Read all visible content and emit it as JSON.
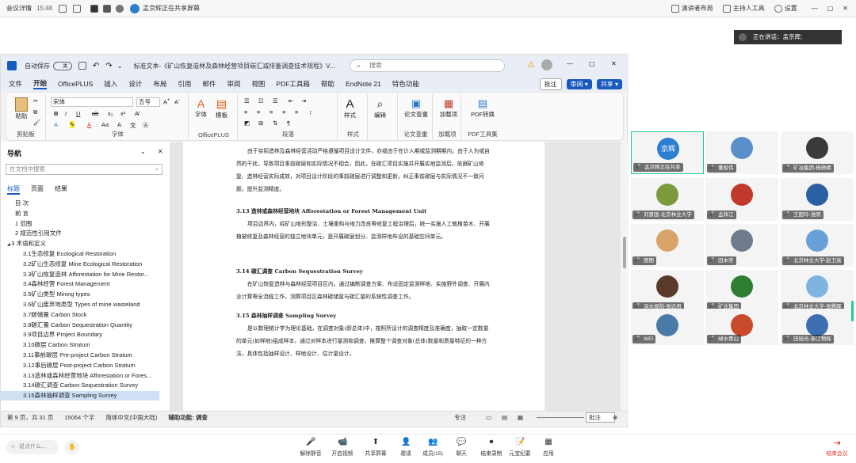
{
  "meeting": {
    "info": "会议详情",
    "time": "15:48",
    "sharing_banner": "孟京辉正在共享屏幕",
    "presenter_layout": "演讲者布局",
    "host_tools": "主持人工具",
    "settings": "设置",
    "speaking_label": "正在讲话：",
    "speaking_name": "孟京辉;"
  },
  "word": {
    "autosave": "自动保存",
    "autosave_state": "关",
    "doc_title": "标准文本-《矿山恢复造林及森林经营项目碳汇减排量调查技术规程》V...",
    "search_placeholder": "搜索",
    "menu": [
      "文件",
      "开始",
      "OfficePLUS",
      "插入",
      "设计",
      "布局",
      "引用",
      "邮件",
      "审阅",
      "视图",
      "PDF工具箱",
      "帮助",
      "EndNote 21",
      "特色功能"
    ],
    "comment_btn": "批注",
    "review_btn": "审阅",
    "share_btn": "共享",
    "ribbon": {
      "paste": "粘贴",
      "clipboard": "剪贴板",
      "font_name": "宋体",
      "font_size": "五号",
      "font_group": "字体",
      "font_btn": "字体",
      "template_btn": "模板",
      "officeplus": "OfficePLUS",
      "paragraph": "段落",
      "styles_btn": "样式",
      "styles_group": "样式",
      "edit_btn": "编辑",
      "paper_check": "论文查重",
      "paper_check_group": "论文查重",
      "addin_btn": "加载项",
      "addin_group": "加载项",
      "pdf_convert": "PDF转换",
      "pdf_group": "PDF工具集"
    },
    "nav": {
      "title": "导航",
      "search_placeholder": "在文档中搜索",
      "tabs": [
        "标题",
        "页面",
        "结果"
      ],
      "items": [
        {
          "text": "目 次",
          "level": 0
        },
        {
          "text": "前 言",
          "level": 0
        },
        {
          "text": "1 范围",
          "level": 0
        },
        {
          "text": "2 规范性引用文件",
          "level": 0
        },
        {
          "text": "3 术语和定义",
          "level": 0,
          "expanded": true
        },
        {
          "text": "3.1生态修复 Ecological Restoration",
          "level": 1
        },
        {
          "text": "3.2矿山生态修复 Mine Ecological Restoration",
          "level": 1
        },
        {
          "text": "3.3矿山恢复造林 Afforestation for Mine Restor...",
          "level": 1
        },
        {
          "text": "3.4森林经营 Forest Management",
          "level": 1
        },
        {
          "text": "3.5矿山类型 Mining types",
          "level": 1
        },
        {
          "text": "3.6矿山废弃地类型 Types of mine wasteland",
          "level": 1
        },
        {
          "text": "3.7碳储量 Carbon Stock",
          "level": 1
        },
        {
          "text": "3.8碳汇量 Carbon Sequestration Quantity",
          "level": 1
        },
        {
          "text": "3.9项目边界 Project Boundary",
          "level": 1
        },
        {
          "text": "3.10碳层 Carbon Stratum",
          "level": 1
        },
        {
          "text": "3.11事前碳层 Pre-project Carbon Stratum",
          "level": 1
        },
        {
          "text": "3.12事后碳层 Post-project Carbon Stratum",
          "level": 1
        },
        {
          "text": "3.13造林或森林经营地块 Afforestation or Fores...",
          "level": 1
        },
        {
          "text": "3.14碳汇调查 Carbon Sequestration Survey",
          "level": 1
        },
        {
          "text": "3.15森林抽样调查 Sampling Survey",
          "level": 1,
          "selected": true
        }
      ]
    },
    "doc": {
      "p1": "由于实际造林及森林经营活动严格遵循项目设计文件，亦或由于在计入期或监测期期内，由于人为或自然的干扰，导致项目事前碳层和实际情况不相合，因此，在碳汇项目实施并开展实地监测后，依据矿山修复、造林经营实际成效，对项目设计阶段的事前碳层进行调整和更新，纠正事前碳层与实际情况不一致问题，提升监测精度。",
      "h313": "3.13 造林或森林经营地块  Afforestation or Forest Management Unit",
      "p313": "项目边界内，经矿山地形整治、土壤重构与地力改良等修复工程治理后，统一实施人工栽植苗木、开展植被修复及森林经营的独立地块单元，是开展碳层划分、监测样地布设的基础空间单元。",
      "h314": "3.14 碳汇调查  Carbon Sequestration Survey",
      "p314": "在矿山恢复造林与森林经营项目区内，通过编制调查方案、布设固定监测样地、实施野外调查、开展内业计算等全流程工作，测算项目区森林碳储量与碳汇量的系统性调查工作。",
      "h315": "3.15 森林抽样调查  Sampling Survey",
      "p315": "是以数理统计学为理论基础，在调查对象(即总体)中，按照所设计的调查精度及准确度，抽取一定数量的单元(如样地)组成样本，通过对样本进行量测和调查，推算整个调查对象(总体)数量和质量特征的一种方法，具体包括抽样设计、样地设计、估计量设计。"
    },
    "status": {
      "page": "第 9 页，共 31 页",
      "words": "15064 个字",
      "lang": "简体中文(中国大陆)",
      "accessibility": "辅助功能: 调查",
      "focus": "专注",
      "comment": "批注"
    }
  },
  "participants": [
    {
      "name": "孟京辉正在共享",
      "avatar_text": "京辉",
      "color": "#2f7fd1"
    },
    {
      "name": "董俊伟",
      "color": "#5b8fc9"
    },
    {
      "name": "矿冶集团-杨旖婧",
      "color": "#3a3a3a"
    },
    {
      "name": "刘晋国-北京林业大学",
      "color": "#7a9a3b"
    },
    {
      "name": "孟祥江",
      "color": "#c0392b"
    },
    {
      "name": "王国玲-淮阴",
      "color": "#2b5fa3"
    },
    {
      "name": "图图",
      "color": "#d9a46a"
    },
    {
      "name": "田本崇",
      "color": "#6d7b8c"
    },
    {
      "name": "北京林业大学-赵卫高",
      "color": "#6aa0d8"
    },
    {
      "name": "深水规院-张远君",
      "color": "#5a3a2a"
    },
    {
      "name": "矿业集团",
      "color": "#2e7d32"
    },
    {
      "name": "北京林业大学-张腾辉",
      "color": "#7fb3e0"
    },
    {
      "name": "WEI",
      "color": "#4a7aa8"
    },
    {
      "name": "绿水青山",
      "color": "#c94a2a"
    },
    {
      "name": "田旭光-浙江物探",
      "color": "#3d6fb0"
    }
  ],
  "bottom": {
    "chat_placeholder": "说点什么...",
    "buttons": [
      "解除静音",
      "开启视频",
      "共享屏幕",
      "邀请",
      "成员(15)",
      "聊天",
      "结束录制",
      "元宝纪要",
      "应用"
    ],
    "leave": "结束会议"
  },
  "colors": {
    "accent": "#185abd",
    "mic_off": "#e53935",
    "leave": "#e53935",
    "selected_tile": "#20c997"
  }
}
